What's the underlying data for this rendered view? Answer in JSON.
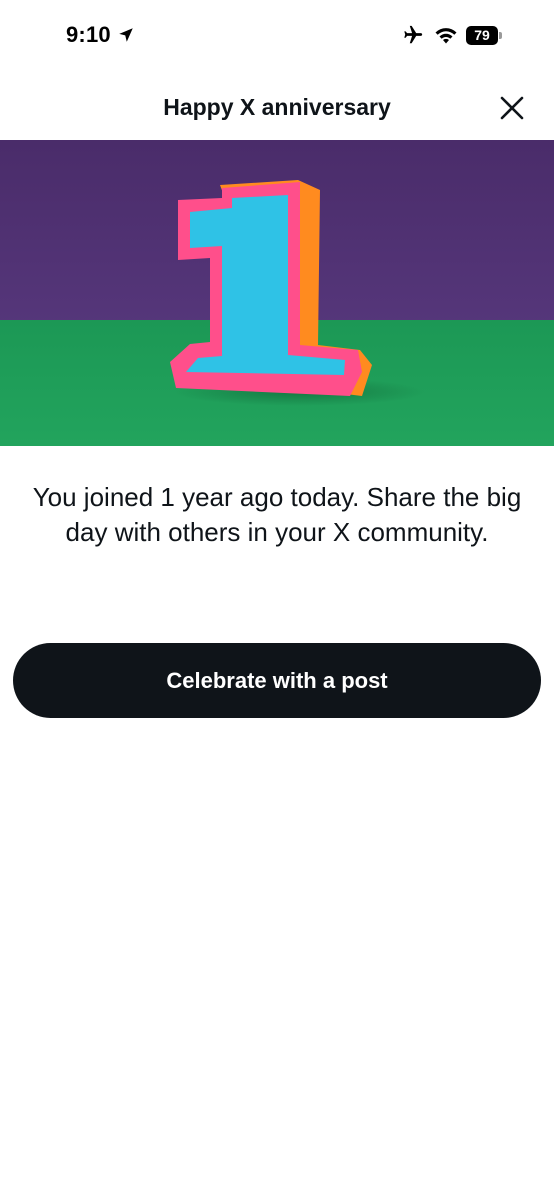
{
  "status_bar": {
    "time": "9:10",
    "battery_level": "79",
    "icons": [
      "location-arrow-icon",
      "airplane-mode-icon",
      "wifi-icon",
      "battery-icon"
    ]
  },
  "header": {
    "title": "Happy X anniversary",
    "close_icon": "close-icon"
  },
  "hero": {
    "colors": {
      "wall": "#4e2f6e",
      "floor": "#1f9a58",
      "numeral_face": "#2fc2e6",
      "numeral_outline": "#ff4f8b",
      "numeral_side": "#ff8b1f"
    }
  },
  "message": {
    "text": "You joined 1 year ago today. Share the big day with others in your X community."
  },
  "cta": {
    "label": "Celebrate with a post",
    "background": "#0f1419",
    "text_color": "#ffffff"
  }
}
